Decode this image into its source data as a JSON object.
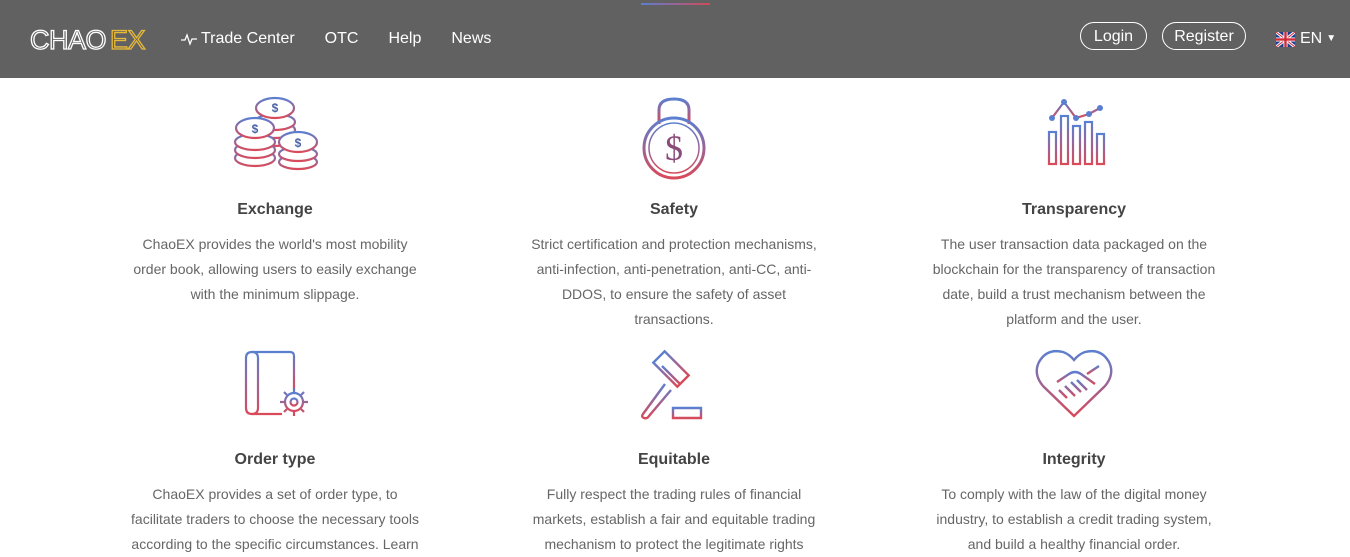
{
  "header": {
    "logo": {
      "part1": "CHAO",
      "part2": "EX"
    },
    "nav": [
      {
        "label": "Trade Center",
        "icon": "pulse-icon"
      },
      {
        "label": "OTC"
      },
      {
        "label": "Help"
      },
      {
        "label": "News"
      }
    ],
    "login_label": "Login",
    "register_label": "Register",
    "language": {
      "code": "EN",
      "icon": "uk-flag-icon"
    }
  },
  "colors": {
    "header_bg": "#616161",
    "icon_gradient_start": "#5b7fd0",
    "icon_gradient_end": "#d94a5a"
  },
  "features": [
    {
      "title": "Exchange",
      "icon": "coins-icon",
      "text": "ChaoEX provides the world's most mobility order book, allowing users to easily exchange with the minimum slippage."
    },
    {
      "title": "Safety",
      "icon": "lock-dollar-icon",
      "text": "Strict certification and protection mechanisms, anti-infection, anti-penetration, anti-CC, anti-DDOS, to ensure the safety of asset transactions."
    },
    {
      "title": "Transparency",
      "icon": "bar-chart-icon",
      "text": "The user transaction data packaged on the blockchain for the transparency of transaction date, build a trust mechanism between the platform and the user."
    },
    {
      "title": "Order type",
      "icon": "document-gear-icon",
      "text": "ChaoEX provides a set of order type, to facilitate traders to choose the necessary tools according to the specific circumstances. Learn"
    },
    {
      "title": "Equitable",
      "icon": "gavel-icon",
      "text": "Fully respect the trading rules of financial markets, establish a fair and equitable trading mechanism to protect the legitimate rights"
    },
    {
      "title": "Integrity",
      "icon": "heart-handshake-icon",
      "text": "To comply with the law of the digital money industry, to establish a credit trading system, and build a healthy financial order."
    }
  ]
}
